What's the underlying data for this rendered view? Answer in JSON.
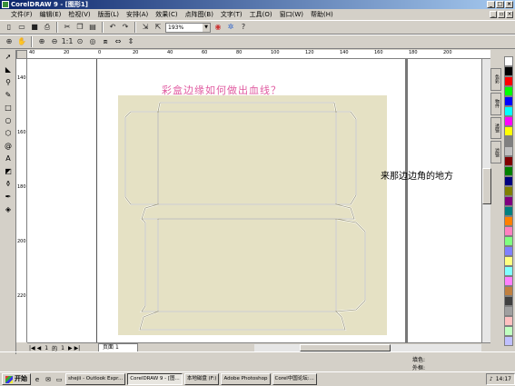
{
  "window": {
    "title": "CorelDRAW 9 - [图形1]"
  },
  "menu": [
    "文件(F)",
    "编辑(E)",
    "检视(V)",
    "版面(L)",
    "安排(A)",
    "效果(C)",
    "点阵图(B)",
    "文字(T)",
    "工具(O)",
    "窗口(W)",
    "帮助(H)"
  ],
  "toolbar": {
    "zoom_value": "193%"
  },
  "rulers": {
    "h": [
      "40",
      "20",
      "0",
      "20",
      "40",
      "60",
      "80",
      "100",
      "120",
      "140",
      "160",
      "180",
      "200"
    ],
    "v": [
      "140",
      "160",
      "180",
      "200",
      "220"
    ]
  },
  "canvas": {
    "question": "彩盒边缘如何做出血线？",
    "side_text": "来那边边角的地方"
  },
  "page_nav": {
    "first": "|◀",
    "prev": "◀",
    "current": "1",
    "of": "的",
    "total": "1",
    "next": "▶",
    "last": "▶|",
    "tab_label": "页面",
    "tab_num": "1"
  },
  "dockers": [
    "色彩",
    "物件",
    "透镜",
    "滤镜"
  ],
  "palette": [
    "#ffffff",
    "#000000",
    "#ff0000",
    "#00ff00",
    "#0000ff",
    "#00ffff",
    "#ff00ff",
    "#ffff00",
    "#808080",
    "#c0c0c0",
    "#800000",
    "#008000",
    "#000080",
    "#808000",
    "#800080",
    "#008080",
    "#ff8000",
    "#ff80c0",
    "#80ff80",
    "#8080ff",
    "#ffff80",
    "#80ffff",
    "#ff80ff",
    "#c08040",
    "#404040",
    "#a0a0a0",
    "#ffc0c0",
    "#c0ffc0",
    "#c0c0ff"
  ],
  "status": {
    "fill_label": "填色:",
    "outline_label": "外框:"
  },
  "taskbar": {
    "start": "开始",
    "tasks": [
      "shejii - Outlook Expr...",
      "CorelDRAW 9 - [图...",
      "本地磁盘 (F:)",
      "Adobe Photoshop",
      "Corel中国论坛:..."
    ],
    "active_index": 1,
    "clock": "14:17"
  }
}
